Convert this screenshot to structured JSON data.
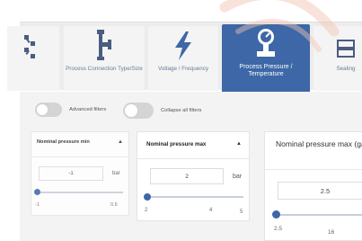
{
  "tabs": [
    {
      "label": "",
      "icon": "pipes-icon",
      "active": false
    },
    {
      "label": "Process Connection Type/Size",
      "icon": "pipe-connection-icon",
      "active": false
    },
    {
      "label": "Voltage / Frequency",
      "icon": "lightning-icon",
      "active": false
    },
    {
      "label": "Process Pressure / Temperature",
      "icon": "pressure-gauge-icon",
      "active": true
    },
    {
      "label": "Sealing",
      "icon": "seal-icon",
      "active": false
    }
  ],
  "filters": {
    "advanced_label": "Advanced filters",
    "collapse_label": "Collapse all filters",
    "advanced_on": false,
    "collapse_on": false
  },
  "cards": {
    "min": {
      "title": "Nominal pressure min",
      "value": "-1",
      "unit": "bar",
      "ticks": [
        "-1",
        "0.5"
      ],
      "slider_position": 0.0
    },
    "max": {
      "title": "Nominal pressure max",
      "value": "2",
      "unit": "bar",
      "ticks": [
        "2",
        "4",
        "5"
      ],
      "slider_position": 0.0
    },
    "gas": {
      "title": "Nominal pressure max (gas)",
      "value": "2.5",
      "ticks": [
        "2.5",
        "16"
      ],
      "slider_position": 0.0
    }
  },
  "colors": {
    "accent": "#3d67a6",
    "tab_bg": "#f4f4f4",
    "panel_bg": "#f3f3f3",
    "watermark": "#f2c6b4"
  }
}
